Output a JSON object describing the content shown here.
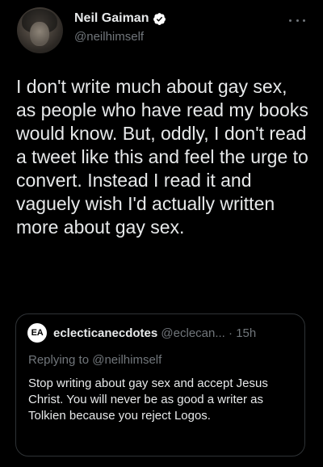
{
  "tweet": {
    "author": {
      "display_name": "Neil Gaiman",
      "handle": "@neilhimself",
      "verified": true
    },
    "text": "I don't write much about gay sex, as people who have read my books would know. But, oddly, I don't read a tweet like this and feel the urge to convert. Instead I read it and vaguely wish I'd actually written more about gay sex.",
    "more_icon": "more-horizontal-icon"
  },
  "quoted_tweet": {
    "avatar_initials": "EA",
    "display_name": "eclecticanecdotes",
    "handle": "@eclecan...",
    "separator": "·",
    "time": "15h",
    "replying_to": "Replying to @neilhimself",
    "text": "Stop writing about gay sex and accept Jesus Christ. You will never be as good a writer as Tolkien because you reject Logos."
  },
  "colors": {
    "background": "#000000",
    "primary_text": "#e7e9ea",
    "secondary_text": "#71767b",
    "verified_badge": "#ffffff",
    "card_border": "#2f3336"
  }
}
